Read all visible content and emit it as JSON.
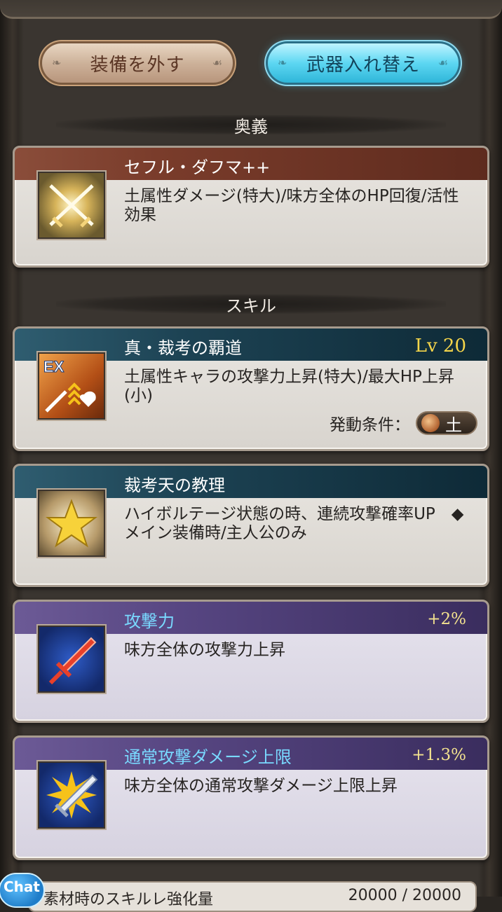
{
  "buttons": {
    "unequip": "装備を外す",
    "swap_weapon": "武器入れ替え"
  },
  "ougi_section": {
    "header": "奥義",
    "card": {
      "title": "セフル・ダフマ++",
      "description": "土属性ダメージ(特大)/味方全体のHP回復/活性効果",
      "icon": "crossed-swords-icon"
    }
  },
  "skill_section": {
    "header": "スキル",
    "skills": [
      {
        "title": "真・裁考の覇道",
        "level": "Lv 20",
        "description": "土属性キャラの攻撃力上昇(特大)/最大HP上昇(小)",
        "condition_label": "発動条件：",
        "condition_element": "土",
        "icon": "ex-skill-icon",
        "icon_badge": "EX"
      },
      {
        "title": "裁考天の教理",
        "description": "ハイボルテージ状態の時、連続攻撃確率UP　◆メイン装備時/主人公のみ",
        "icon": "star-icon"
      },
      {
        "title": "攻撃力",
        "bonus": "+2%",
        "description": "味方全体の攻撃力上昇",
        "icon": "sword-red-icon"
      },
      {
        "title": "通常攻撃ダメージ上限",
        "bonus": "+1.3%",
        "description": "味方全体の通常攻撃ダメージ上限上昇",
        "icon": "sword-burst-icon"
      }
    ]
  },
  "bottom": {
    "label": "素材時のスキルレ強化量",
    "value": "20000 / 20000"
  },
  "chat": {
    "label": "Chat"
  }
}
